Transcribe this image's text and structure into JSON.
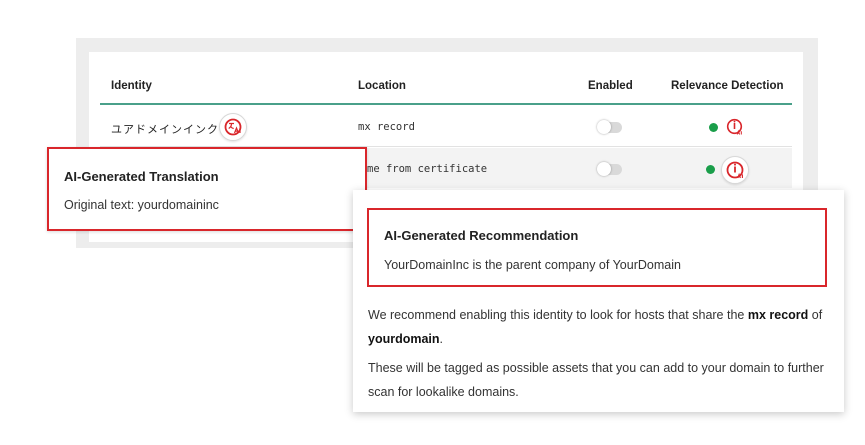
{
  "table": {
    "headers": {
      "identity": "Identity",
      "location": "Location",
      "enabled": "Enabled",
      "relevance": "Relevance Detection"
    },
    "rows": [
      {
        "identity": "ユアドメインインク",
        "location": "mx record",
        "enabled": false,
        "relevance": "green"
      },
      {
        "identity": "",
        "location": "me from certificate",
        "enabled": false,
        "relevance": "green"
      }
    ]
  },
  "translation_popup": {
    "title": "AI-Generated Translation",
    "body": "Original text: yourdomaininc"
  },
  "recommendation_popup": {
    "title": "AI-Generated Recommendation",
    "body": "YourDomainInc is the parent company of YourDomain",
    "para1": {
      "part1": "We recommend enabling this identity to look for hosts that share the ",
      "bold1": "mx record",
      "part2": " of ",
      "bold2": "yourdomain",
      "part3": "."
    },
    "para2": "These will be tagged as possible assets that you can add to your domain to further scan for lookalike domains."
  },
  "icons": {
    "translate_ai_icon": "translate-ai-icon",
    "ai_info_icon": "ai-info-icon",
    "status_dot": "green-dot"
  },
  "colors": {
    "accent_red": "#d9262b",
    "header_line": "#4aa08a",
    "status_green": "#1a9e4a"
  }
}
